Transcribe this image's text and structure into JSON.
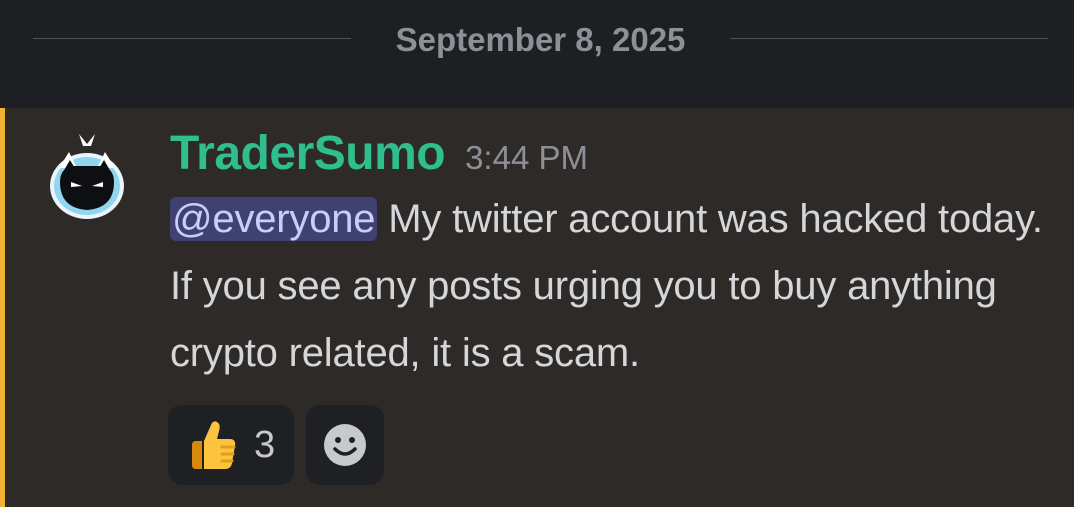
{
  "date_divider": {
    "label": "September 8, 2025"
  },
  "message": {
    "author": "TraderSumo",
    "timestamp": "3:44 PM",
    "mention": "@everyone",
    "text": " My twitter account was hacked today. If you see any posts urging you to buy anything crypto related, it is a scam.",
    "avatar_icon": "ninja-cat-avatar"
  },
  "reactions": [
    {
      "emoji": "thumbs-up-icon",
      "count": "3"
    },
    {
      "emoji": "add-reaction-icon"
    }
  ],
  "colors": {
    "background": "#1e1f22",
    "message_highlight": "#2d2a27",
    "mention_bar": "#f0b232",
    "username": "#2fbf8e",
    "mention_bg": "#3f4172",
    "mention_text": "#c9cdfb"
  }
}
